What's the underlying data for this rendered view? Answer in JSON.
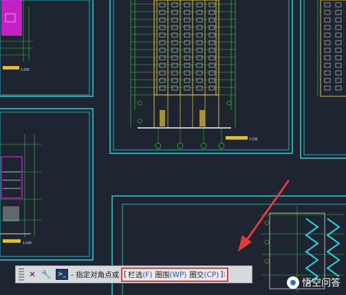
{
  "canvas": {
    "scale_label_1": "1:100",
    "scale_label_2": "1:100",
    "floor_plan_caption": "1:100"
  },
  "command_line": {
    "prompt_icon_text": ">_",
    "prompt_text": "- 指定对角点或",
    "open_bracket": "[",
    "close_bracket": "]:",
    "options": [
      {
        "label": "栏选",
        "key": "(F)"
      },
      {
        "label": "圈围",
        "key": "(WP)"
      },
      {
        "label": "圈交",
        "key": "(CP)"
      }
    ]
  },
  "watermark": {
    "text": "悟空问答"
  },
  "colors": {
    "background": "#1f2530",
    "frame": "#25d6e8",
    "highlight": "#e53a3a",
    "drawing_yellow": "#e0c030",
    "drawing_green": "#2ecf3a",
    "drawing_magenta": "#e020e0"
  }
}
